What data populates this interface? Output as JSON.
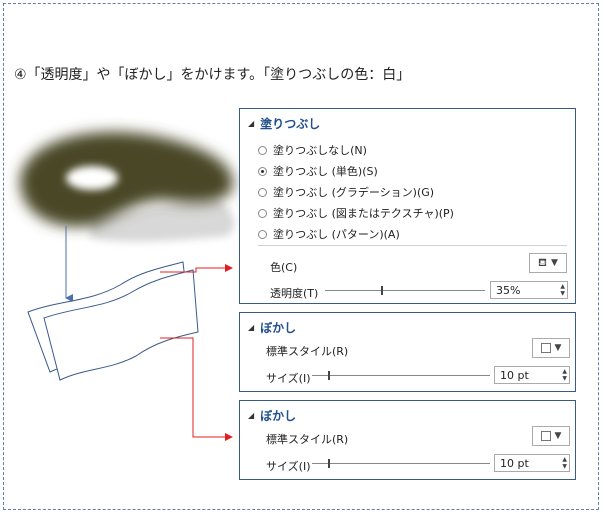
{
  "step_text": "④「透明度」や「ぼかし」をかけます。「塗りつぶしの色：白」",
  "fill_panel": {
    "header": "塗りつぶし",
    "options": [
      {
        "label": "塗りつぶしなし(N)",
        "selected": false
      },
      {
        "label": "塗りつぶし (単色)(S)",
        "selected": true
      },
      {
        "label": "塗りつぶし (グラデーション)(G)",
        "selected": false
      },
      {
        "label": "塗りつぶし (図またはテクスチャ)(P)",
        "selected": false
      },
      {
        "label": "塗りつぶし (パターン)(A)",
        "selected": false
      }
    ],
    "color_label": "色(C)",
    "transparency_label": "透明度(T)",
    "transparency_value": "35%",
    "transparency_fraction": 0.35
  },
  "blur_panel_1": {
    "header": "ぼかし",
    "style_label": "標準スタイル(R)",
    "size_label": "サイズ(I)",
    "size_value": "10 pt"
  },
  "blur_panel_2": {
    "header": "ぼかし",
    "style_label": "標準スタイル(R)",
    "size_label": "サイズ(I)",
    "size_value": "10 pt"
  },
  "colors": {
    "accent_blue": "#1f4e8c",
    "arrow_red": "#e02020",
    "shape_olive": "#4a4628"
  }
}
